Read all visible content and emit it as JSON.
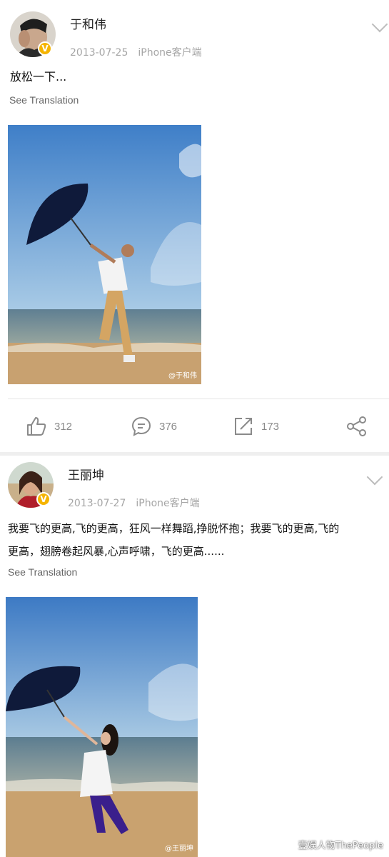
{
  "posts": [
    {
      "username": "于和伟",
      "date": "2013-07-25",
      "source": "iPhone客户端",
      "text": "放松一下...",
      "see_translation": "See Translation",
      "verified_icon": "v-badge-icon",
      "photo": {
        "description_icon": "beach-umbrella-man-photo",
        "watermark": "@于和伟"
      },
      "actions": {
        "likes": "312",
        "comments": "376",
        "reposts": "173"
      }
    },
    {
      "username": "王丽坤",
      "date": "2013-07-27",
      "source": "iPhone客户端",
      "text_line1": "我要飞的更高,飞的更高，狂风一样舞蹈,挣脱怀抱；我要飞的更高,飞的",
      "text_line2": "更高，翅膀卷起风暴,心声呼啸，飞的更高......",
      "see_translation": "See Translation",
      "verified_icon": "v-badge-icon",
      "photo": {
        "description_icon": "beach-umbrella-woman-photo",
        "watermark": "@王丽坤"
      }
    }
  ],
  "footer_watermark": "壹娱人物ThePeople",
  "colors": {
    "verified": "#f5b400",
    "meta_gray": "#a6a6a6",
    "icon_gray": "#8a8a8a"
  }
}
